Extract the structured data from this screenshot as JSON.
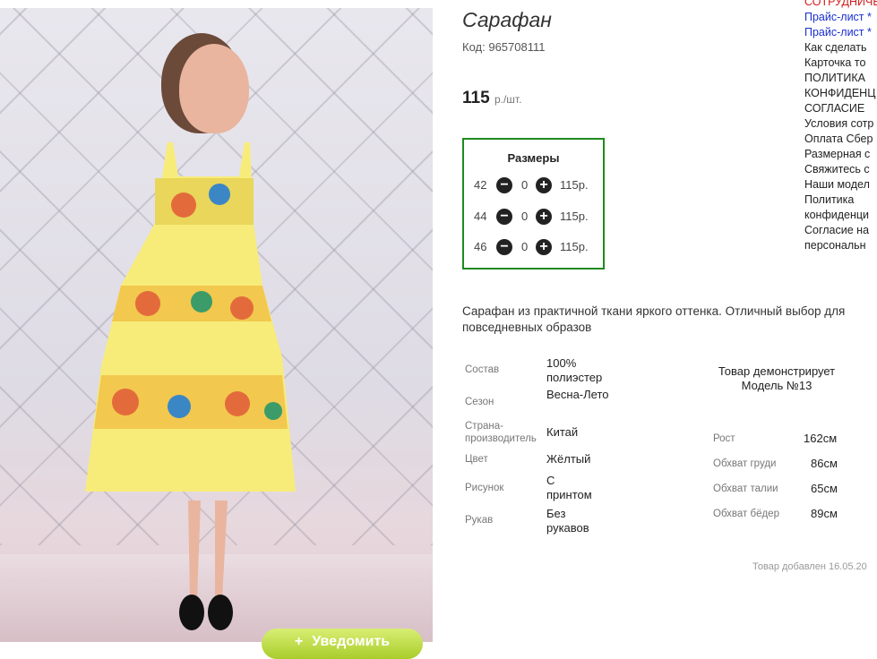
{
  "product": {
    "title": "Сарафан",
    "code_label": "Код:",
    "code": "965708111",
    "price": "115",
    "price_unit": "р./шт.",
    "description": "Сарафан из практичной ткани яркого оттенка. Отличный выбор для повседневных образов",
    "added": "Товар добавлен 16.05.20"
  },
  "sizes": {
    "heading": "Размеры",
    "rows": [
      {
        "size": "42",
        "qty": "0",
        "price": "115р."
      },
      {
        "size": "44",
        "qty": "0",
        "price": "115р."
      },
      {
        "size": "46",
        "qty": "0",
        "price": "115р."
      }
    ]
  },
  "attributes": [
    {
      "label": "Состав",
      "value": "100% полиэстер"
    },
    {
      "label": "Сезон",
      "value": "Весна-Лето"
    },
    {
      "label": "Страна-производитель",
      "value": "Китай"
    },
    {
      "label": "Цвет",
      "value": "Жёлтый"
    },
    {
      "label": "Рисунок",
      "value": "С принтом"
    },
    {
      "label": "Рукав",
      "value": "Без рукавов"
    }
  ],
  "model": {
    "title": "Товар демонстрирует Модель №13",
    "measurements": [
      {
        "label": "Рост",
        "value": "162см"
      },
      {
        "label": "Обхват груди",
        "value": "86см"
      },
      {
        "label": "Обхват талии",
        "value": "65см"
      },
      {
        "label": "Обхват бёдер",
        "value": "89см"
      }
    ]
  },
  "cart_button": {
    "label": "Уведомить"
  },
  "sidebar": {
    "links": [
      {
        "label": "СОТРУДНИЧЕ",
        "style": "red"
      },
      {
        "label": "Прайс-лист *",
        "style": "blue"
      },
      {
        "label": "Прайс-лист *",
        "style": "blue"
      },
      {
        "label": "Как сделать",
        "style": "dark"
      },
      {
        "label": "Карточка то",
        "style": "dark"
      },
      {
        "label": "ПОЛИТИКА",
        "style": "dark"
      },
      {
        "label": "КОНФИДЕНЦ",
        "style": "dark"
      },
      {
        "label": "СОГЛАСИЕ",
        "style": "dark"
      },
      {
        "label": "Условия сотр",
        "style": "dark"
      },
      {
        "label": "Оплата Сбер",
        "style": "dark"
      },
      {
        "label": "Размерная с",
        "style": "dark"
      },
      {
        "label": "Свяжитесь с",
        "style": "dark"
      },
      {
        "label": "Наши модел",
        "style": "dark"
      },
      {
        "label": "Политика",
        "style": "dark"
      },
      {
        "label": "конфиденци",
        "style": "dark"
      },
      {
        "label": "Согласие на",
        "style": "dark"
      },
      {
        "label": "персональн",
        "style": "dark"
      }
    ]
  },
  "colors": {
    "accent_border": "#1f8a1f",
    "cart_green": "#a9cc2a",
    "link_blue": "#1a2fd0",
    "link_red": "#d21b1b"
  }
}
